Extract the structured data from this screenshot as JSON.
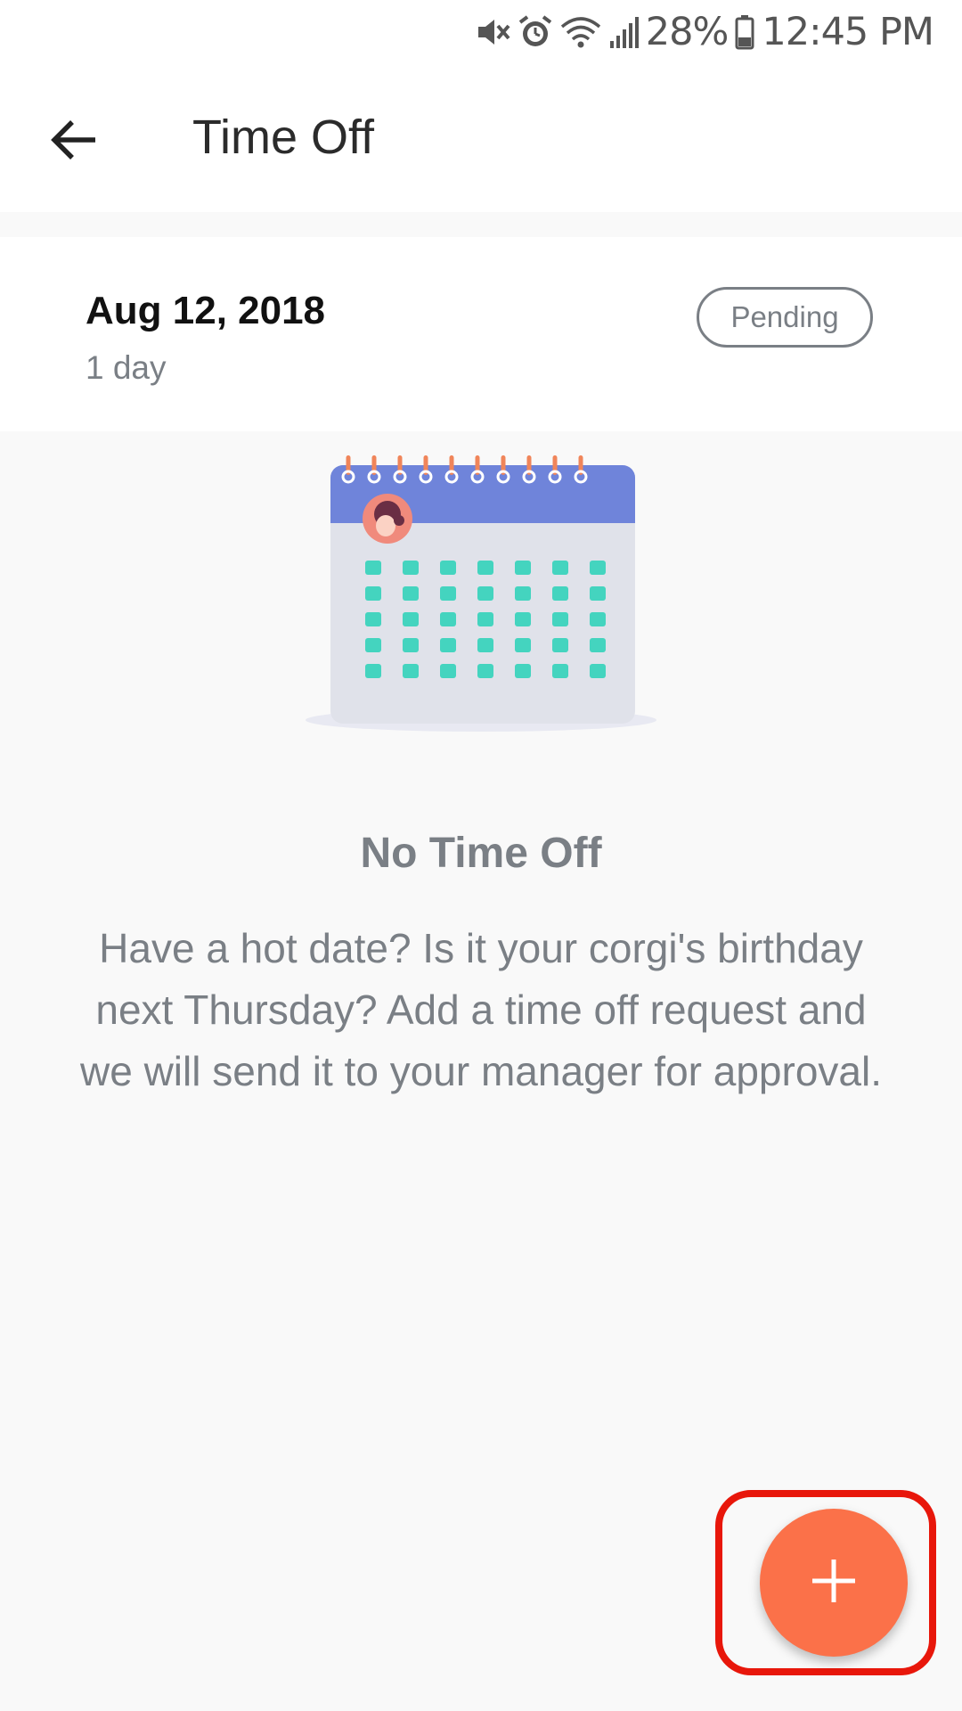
{
  "status_bar": {
    "battery": "28%",
    "time": "12:45 PM",
    "icons": [
      "mute-icon",
      "alarm-icon",
      "wifi-icon",
      "signal-icon",
      "battery-icon"
    ]
  },
  "toolbar": {
    "title": "Time Off",
    "back_icon": "arrow-left-icon"
  },
  "request": {
    "date": "Aug 12, 2018",
    "duration": "1 day",
    "status": "Pending"
  },
  "empty_state": {
    "title": "No Time Off",
    "body": "Have a hot date? Is it your corgi's birthday next Thursday? Add a time off request and we will send it to your manager for approval."
  },
  "fab": {
    "icon": "plus-icon"
  },
  "colors": {
    "accent": "#fb7149",
    "highlight": "#e8170b",
    "calendar_header": "#6f84da",
    "calendar_dots": "#44d4bf",
    "muted_text": "#7a7f85"
  }
}
